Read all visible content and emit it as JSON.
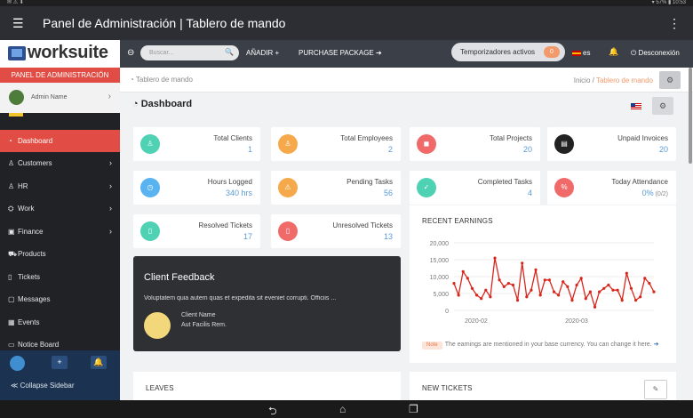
{
  "status_bar": {
    "left": "✉ ⚠ ⬇",
    "right": "▾ 57% ▮ 10:53"
  },
  "appbar": {
    "title": "Panel de Administración | Tablero de mando",
    "menu_icon": "☰",
    "more_icon": "⋮"
  },
  "sidebar": {
    "logo": "worksuite",
    "panel_label": "PANEL DE ADMINISTRACIÓN",
    "user_name": "Admin Name",
    "items": [
      {
        "label": "Dashboard",
        "icon": "◔",
        "chevron": ""
      },
      {
        "label": "Customers",
        "icon": "♙",
        "chevron": "›"
      },
      {
        "label": "HR",
        "icon": "♙",
        "chevron": "›"
      },
      {
        "label": "Work",
        "icon": "⛭",
        "chevron": "›"
      },
      {
        "label": "Finance",
        "icon": "▣",
        "chevron": "›"
      },
      {
        "label": "Products",
        "icon": "⛟",
        "chevron": ""
      },
      {
        "label": "Tickets",
        "icon": "▯",
        "chevron": ""
      },
      {
        "label": "Messages",
        "icon": "▢",
        "chevron": ""
      },
      {
        "label": "Events",
        "icon": "▦",
        "chevron": ""
      },
      {
        "label": "Notice Board",
        "icon": "▭",
        "chevron": ""
      }
    ],
    "collapse_label": "≪ Collapse Sidebar"
  },
  "toolbar": {
    "search_placeholder": "Buscar...",
    "add_label": "AÑADIR +",
    "purchase_label": "PURCHASE PACKAGE ➔",
    "timers_label": "Temporizadores activos",
    "timers_count": "0",
    "lang": "es",
    "logout": "⏻ Desconexión"
  },
  "crumbs": {
    "page": "◔ Tablero de mando",
    "home": "Inicio",
    "sep": "/",
    "current": "Tablero de mando"
  },
  "dashboard_title": "◔ Dashboard",
  "cards": [
    {
      "label": "Total Clients",
      "value": "1",
      "color": "#4fd1b4",
      "icon": "♙"
    },
    {
      "label": "Total Employees",
      "value": "2",
      "color": "#f6a94a",
      "icon": "♙"
    },
    {
      "label": "Total Projects",
      "value": "20",
      "color": "#f06a6a",
      "icon": "◼"
    },
    {
      "label": "Unpaid Invoices",
      "value": "20",
      "color": "#222222",
      "icon": "▤"
    },
    {
      "label": "Hours Logged",
      "value": "340 hrs",
      "color": "#58b3f0",
      "icon": "◷"
    },
    {
      "label": "Pending Tasks",
      "value": "56",
      "color": "#f6a94a",
      "icon": "⚠"
    },
    {
      "label": "Completed Tasks",
      "value": "4",
      "color": "#4fd1b4",
      "icon": "✓"
    },
    {
      "label": "Today Attendance",
      "value": "0%",
      "sub": " (0/2)",
      "color": "#f06a6a",
      "icon": "%"
    },
    {
      "label": "Resolved Tickets",
      "value": "17",
      "color": "#4fd1b4",
      "icon": "▯"
    },
    {
      "label": "Unresolved Tickets",
      "value": "13",
      "color": "#f06a6a",
      "icon": "▯"
    }
  ],
  "feedback": {
    "title": "Client Feedback",
    "quote": "Voluptatem quia autem quas et expedita sit eveniet corrupti. Officiis ...",
    "client_name": "Client Name",
    "company": "Aut Facilis Rem."
  },
  "earnings": {
    "title": "RECENT EARNINGS",
    "note_tag": "Note",
    "note": "The earnings are mentioned in your base currency. You can change it here.",
    "link_icon": "➔"
  },
  "chart_data": {
    "type": "line",
    "title": "RECENT EARNINGS",
    "xlabel": "",
    "ylabel": "",
    "ylim": [
      0,
      20000
    ],
    "yticks": [
      "20,000",
      "15,000",
      "10,000",
      "5,000",
      "0"
    ],
    "xticks": [
      "2020-02",
      "2020-03"
    ],
    "color": "#d9261c",
    "values": [
      8000,
      4500,
      11500,
      9500,
      6500,
      4500,
      3500,
      6000,
      4000,
      15500,
      9000,
      7000,
      8000,
      7500,
      3000,
      14000,
      4000,
      6000,
      12000,
      4500,
      9000,
      9000,
      5500,
      4500,
      8500,
      7000,
      3000,
      7500,
      9500,
      3500,
      5500,
      1000,
      5500,
      6500,
      7500,
      6000,
      6000,
      3000,
      11000,
      6500,
      3000,
      4000,
      9500,
      8000,
      5500
    ]
  },
  "panels": {
    "leaves": "LEAVES",
    "new_tickets": "NEW TICKETS"
  },
  "navbar": {
    "back": "⮌",
    "home": "⌂",
    "recent": "❐"
  }
}
